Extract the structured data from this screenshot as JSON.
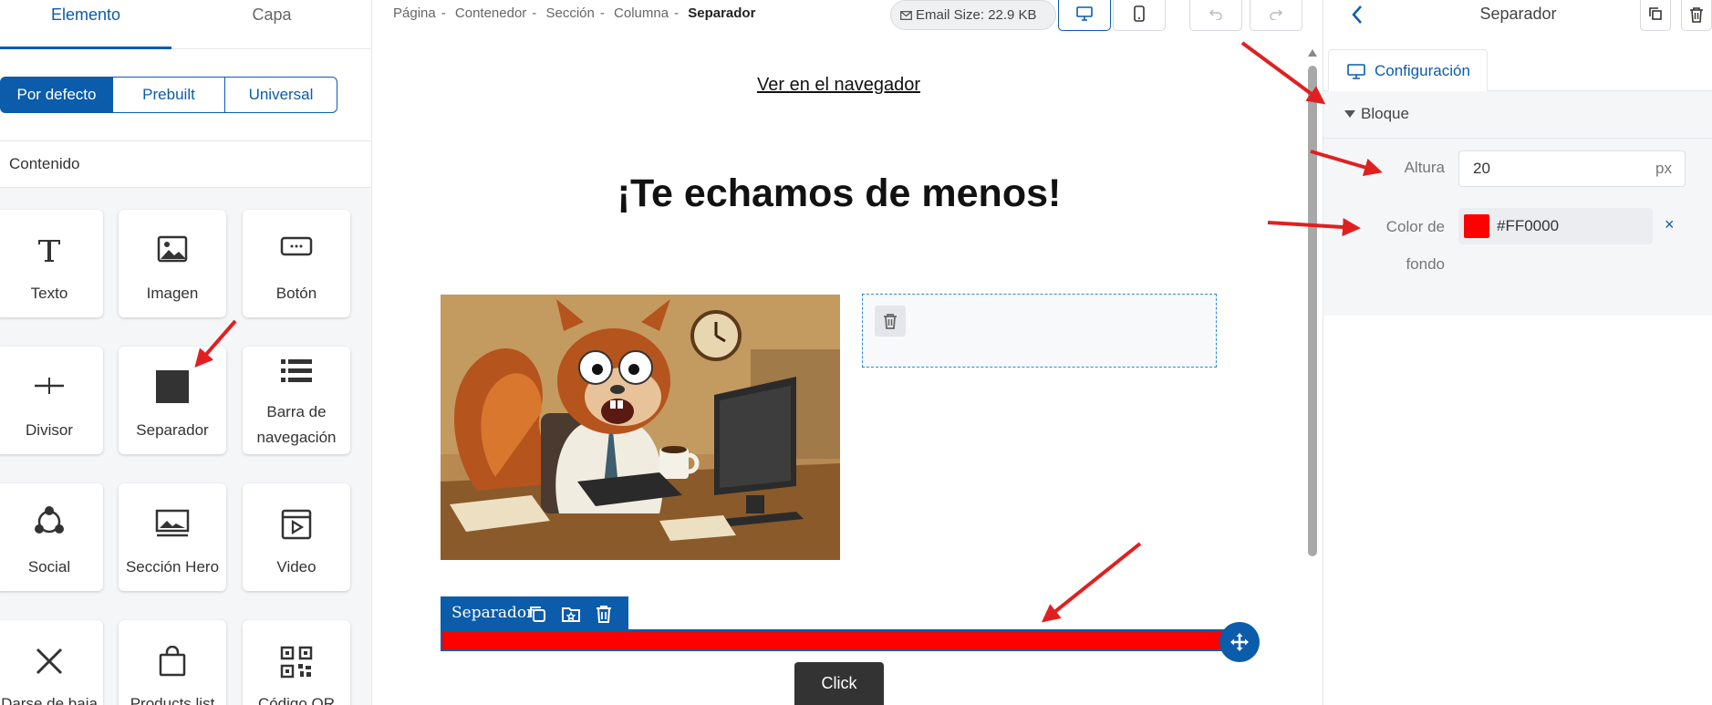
{
  "left": {
    "tabs": [
      "Elemento",
      "Capa"
    ],
    "segments": [
      "Por defecto",
      "Prebuilt",
      "Universal"
    ],
    "section_title": "Contenido",
    "tiles": [
      {
        "label": "Texto",
        "icon": "text-icon"
      },
      {
        "label": "Imagen",
        "icon": "image-icon"
      },
      {
        "label": "Botón",
        "icon": "button-icon"
      },
      {
        "label": "Divisor",
        "icon": "divider-icon"
      },
      {
        "label": "Separador",
        "icon": "spacer-icon"
      },
      {
        "label": "Barra de navegación",
        "icon": "navbar-icon"
      },
      {
        "label": "Social",
        "icon": "social-icon"
      },
      {
        "label": "Sección Hero",
        "icon": "hero-icon"
      },
      {
        "label": "Video",
        "icon": "video-icon"
      },
      {
        "label": "Darse de baja",
        "icon": "unsubscribe-icon"
      },
      {
        "label": "Products list",
        "icon": "products-icon"
      },
      {
        "label": "Código QR",
        "icon": "qr-icon"
      }
    ]
  },
  "center": {
    "breadcrumb": [
      "Página",
      "Contenedor",
      "Sección",
      "Columna"
    ],
    "breadcrumb_current": "Separador",
    "breadcrumb_separator": "-",
    "email_size": "Email Size: 22.9 KB",
    "view_link": "Ver en el navegador",
    "headline": "¡Te echamos de menos!",
    "separator_toolbar_label": "Separador",
    "click_button": "Click",
    "separator_color": "#FF0000"
  },
  "right": {
    "title": "Separador",
    "tab": "Configuración",
    "section": "Bloque",
    "height_label": "Altura",
    "height_value": "20",
    "height_unit": "px",
    "color_label_1": "Color de",
    "color_label_2": "fondo",
    "color_value": "#FF0000",
    "clear_symbol": "×"
  },
  "colors": {
    "accent": "#0b5cab",
    "annotation_arrow": "#e02020"
  }
}
